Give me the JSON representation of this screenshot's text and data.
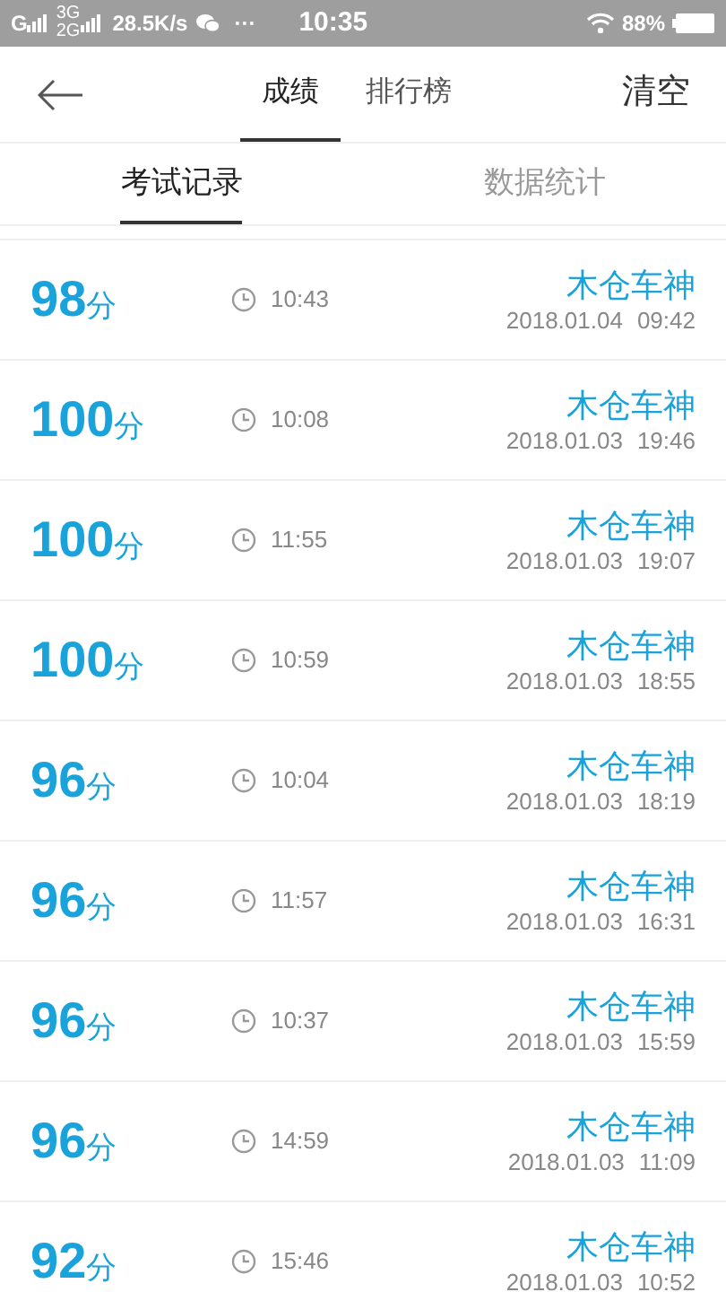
{
  "status_bar": {
    "carrier_1": "G",
    "carrier_2_top": "3G",
    "carrier_2_bottom": "2G",
    "speed": "28.5K/s",
    "more": "···",
    "time": "10:35",
    "battery": "88%"
  },
  "header": {
    "tabs": [
      {
        "label": "成绩",
        "selected": true
      },
      {
        "label": "排行榜",
        "selected": false
      }
    ],
    "action": "清空"
  },
  "sub_tabs": [
    {
      "label": "考试记录",
      "selected": true
    },
    {
      "label": "数据统计",
      "selected": false
    }
  ],
  "records": [
    {
      "score": "98",
      "unit": "分",
      "duration": "10:43",
      "name": "木仓车神",
      "date": "2018.01.04",
      "time": "09:42"
    },
    {
      "score": "100",
      "unit": "分",
      "duration": "10:08",
      "name": "木仓车神",
      "date": "2018.01.03",
      "time": "19:46"
    },
    {
      "score": "100",
      "unit": "分",
      "duration": "11:55",
      "name": "木仓车神",
      "date": "2018.01.03",
      "time": "19:07"
    },
    {
      "score": "100",
      "unit": "分",
      "duration": "10:59",
      "name": "木仓车神",
      "date": "2018.01.03",
      "time": "18:55"
    },
    {
      "score": "96",
      "unit": "分",
      "duration": "10:04",
      "name": "木仓车神",
      "date": "2018.01.03",
      "time": "18:19"
    },
    {
      "score": "96",
      "unit": "分",
      "duration": "11:57",
      "name": "木仓车神",
      "date": "2018.01.03",
      "time": "16:31"
    },
    {
      "score": "96",
      "unit": "分",
      "duration": "10:37",
      "name": "木仓车神",
      "date": "2018.01.03",
      "time": "15:59"
    },
    {
      "score": "96",
      "unit": "分",
      "duration": "14:59",
      "name": "木仓车神",
      "date": "2018.01.03",
      "time": "11:09"
    },
    {
      "score": "92",
      "unit": "分",
      "duration": "15:46",
      "name": "木仓车神",
      "date": "2018.01.03",
      "time": "10:52"
    }
  ]
}
